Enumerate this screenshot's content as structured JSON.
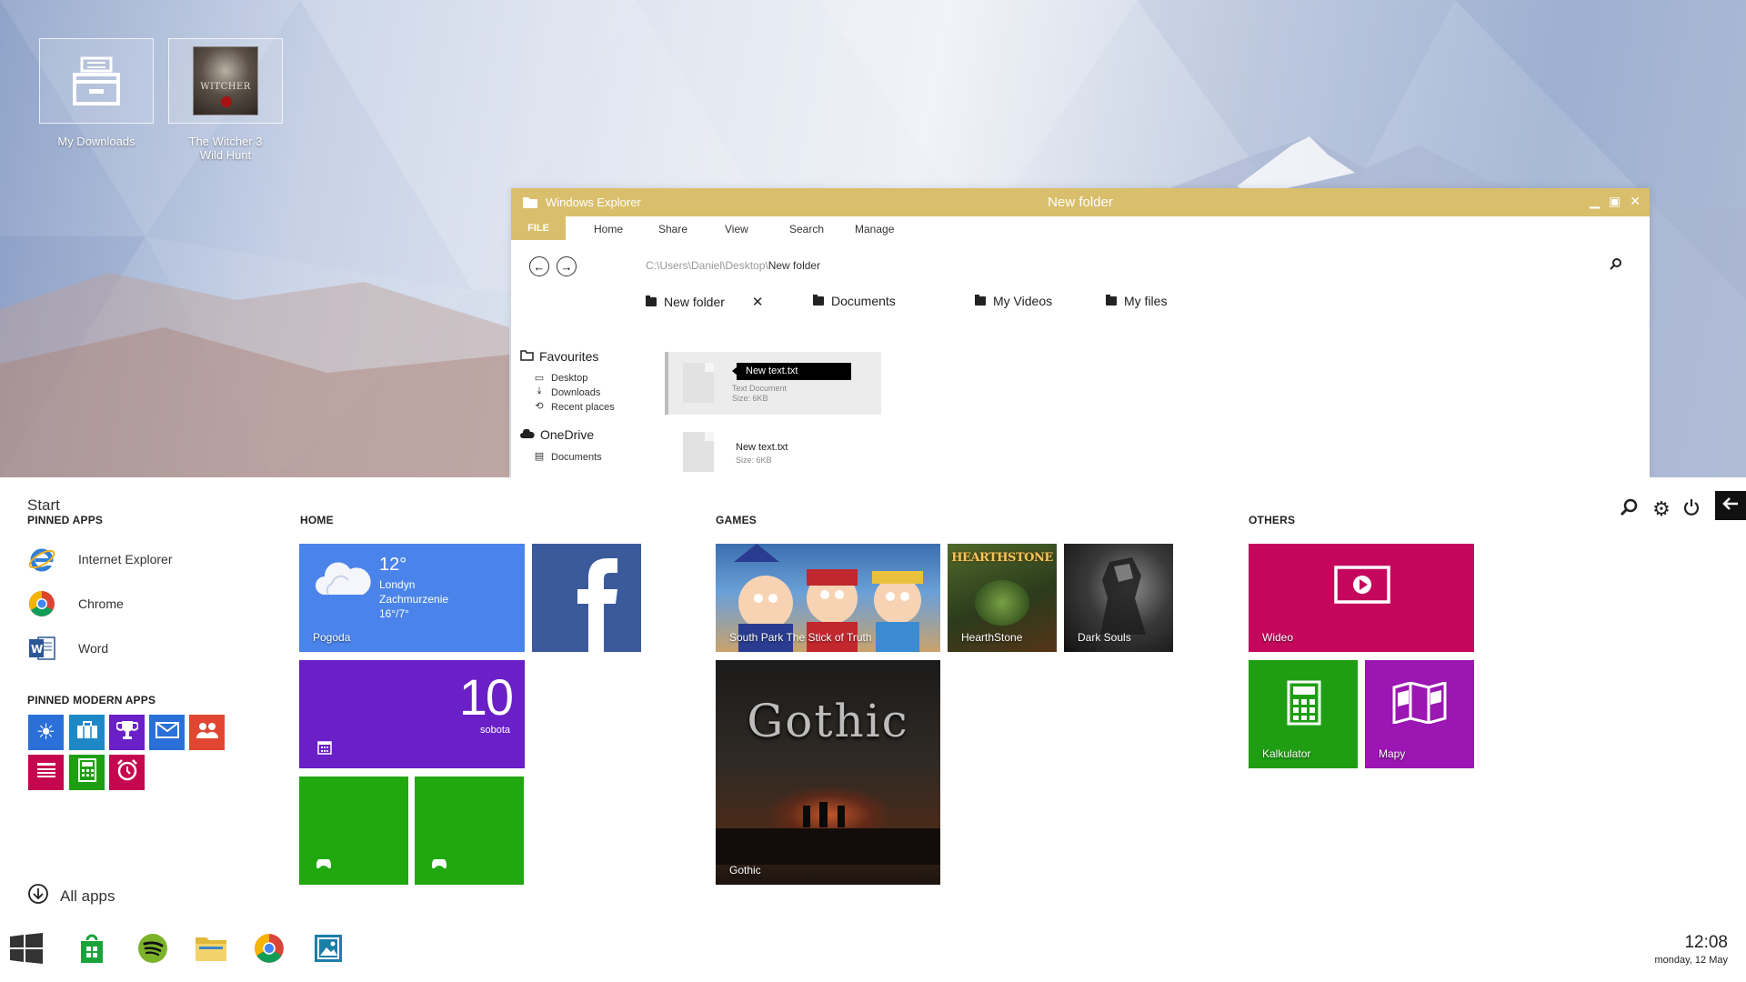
{
  "desktop": {
    "icons": [
      {
        "label": "My Downloads"
      },
      {
        "label": "The Witcher 3 Wild Hunt"
      }
    ],
    "witcher_logo": "WITCHER"
  },
  "explorer": {
    "app_title": "Windows Explorer",
    "window_title": "New folder",
    "ribbon": {
      "file": "FILE",
      "tabs": [
        "Home",
        "Share",
        "View",
        "Search",
        "Manage"
      ]
    },
    "path_prefix": "C:\\Users\\Daniel\\Desktop\\",
    "path_current": "New folder",
    "quick_access": [
      "New folder",
      "Documents",
      "My Videos",
      "My files"
    ],
    "sidebar": {
      "favourites": "Favourites",
      "favourite_items": [
        "Desktop",
        "Downloads",
        "Recent places"
      ],
      "onedrive": "OneDrive",
      "onedrive_items": [
        "Documents"
      ]
    },
    "files": [
      {
        "name": "New text.txt",
        "type": "Text Document",
        "size": "Size: 6KB",
        "selected": true
      },
      {
        "name": "New text.txt",
        "size": "Size: 6KB",
        "selected": false
      }
    ]
  },
  "start": {
    "title": "Start",
    "pinned_header": "PINNED APPS",
    "pinned_apps": [
      "Internet Explorer",
      "Chrome",
      "Word"
    ],
    "modern_header": "PINNED MODERN APPS",
    "all_apps": "All apps",
    "groups": {
      "home": "HOME",
      "games": "GAMES",
      "others": "OTHERS"
    },
    "weather": {
      "temp": "12°",
      "city": "Londyn",
      "condition": "Zachmurzenie",
      "range": "16°/7°",
      "label": "Pogoda"
    },
    "calendar": {
      "day": "10",
      "weekday": "sobota"
    },
    "games": [
      "South Park The Stick of Truth",
      "HearthStone",
      "Dark Souls",
      "Gothic"
    ],
    "hearthstone_logo": "HEARTHSTONE",
    "gothic_logo": "Gothic",
    "others": [
      "Wideo",
      "Kalkulator",
      "Mapy"
    ]
  },
  "taskbar": {
    "time": "12:08",
    "date": "monday, 12 May"
  },
  "colors": {
    "explorer_accent": "#d9bf6b",
    "weather_tile": "#4a84ea",
    "facebook_tile": "#3b5a9b",
    "calendar_tile": "#6a1fc7",
    "xbox_tile": "#20a80e",
    "video_tile": "#c4075c",
    "calc_tile": "#1f9e13",
    "maps_tile": "#9b16b3"
  }
}
